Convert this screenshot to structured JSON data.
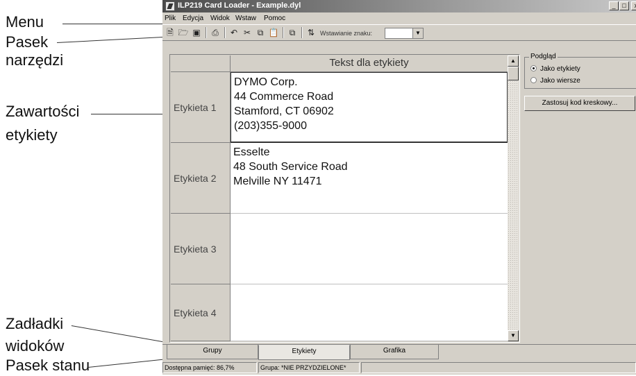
{
  "callouts": {
    "menu": "Menu",
    "toolbar_line1": "Pasek",
    "toolbar_line2": "narzędzi",
    "contents_line1": "Zawartości",
    "contents_line2": "etykiety",
    "tabs_line1": "Zadładki",
    "tabs_line2": "widoków",
    "status": "Pasek stanu"
  },
  "window": {
    "title": "ILP219 Card Loader - Example.dyl",
    "minimize": "_",
    "maximize": "□",
    "close": "x"
  },
  "menu": [
    "Plik",
    "Edycja",
    "Widok",
    "Wstaw",
    "Pomoc"
  ],
  "toolbar": {
    "icons": [
      "new-icon",
      "open-icon",
      "save-icon",
      "print-icon",
      "undo-icon",
      "cut-icon",
      "copy-icon",
      "paste-icon",
      "import-icon",
      "sort-icon"
    ],
    "insert_label": "Wstawianie znaku:",
    "insert_value": ""
  },
  "grid": {
    "column_header": "Tekst dla etykiety",
    "rows": [
      {
        "label": "Etykieta 1",
        "text": "DYMO Corp.\n44 Commerce Road\nStamford, CT  06902\n(203)355-9000"
      },
      {
        "label": "Etykieta 2",
        "text": "Esselte\n48 South Service Road\nMelville NY 11471"
      },
      {
        "label": "Etykieta 3",
        "text": ""
      },
      {
        "label": "Etykieta 4",
        "text": ""
      }
    ]
  },
  "preview": {
    "legend": "Podgląd",
    "option_labels": "Jako etykiety",
    "option_rows": "Jako wiersze"
  },
  "barcode_button": "Zastosuj kod kreskowy...",
  "tabs": [
    "Grupy",
    "Etykiety",
    "Grafika"
  ],
  "status": {
    "memory": "Dostępna pamięć: 86,7%",
    "group": "Grupa: *NIE PRZYDZIELONE*"
  }
}
